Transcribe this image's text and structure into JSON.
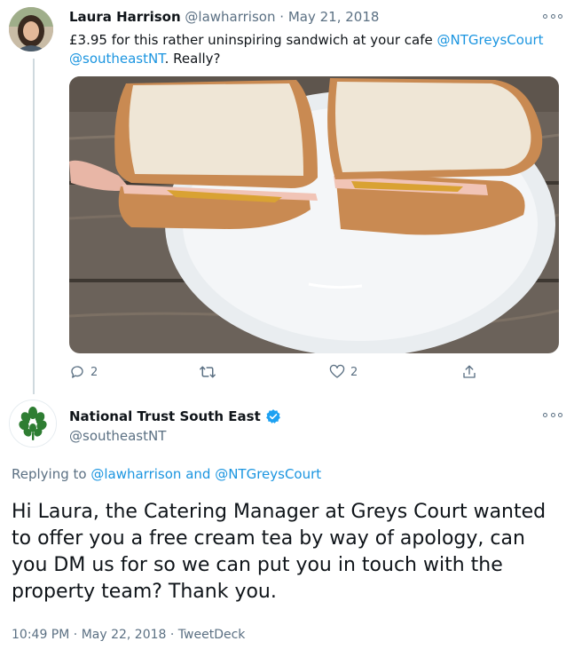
{
  "tweet1": {
    "author_name": "Laura Harrison",
    "author_handle": "@lawharrison",
    "separator": "·",
    "date": "May 21, 2018",
    "text_before": "£3.95 for this rather uninspiring sandwich at your cafe ",
    "mention_1": "@NTGreysCourt",
    "mention_2": "@southeastNT",
    "text_after": ". Really?",
    "reply_count": "2",
    "like_count": "2",
    "photo_icon": "photo-sandwich"
  },
  "tweet2": {
    "author_name": "National Trust South East",
    "author_handle": "@southeastNT",
    "verified_icon": "verified-badge-icon",
    "replying_prefix": "Replying to ",
    "replying_user_1": "@lawharrison",
    "replying_and": " and ",
    "replying_user_2": "@NTGreysCourt",
    "text": "Hi Laura, the Catering Manager at Greys Court wanted to offer you a free cream tea by way of apology, can you DM us for so we can put you in touch with the property team? Thank you.",
    "time": "10:49 PM",
    "separator_1": "·",
    "date": "May 22, 2018",
    "separator_2": "·",
    "source": "TweetDeck"
  },
  "colors": {
    "link": "#1b95e0",
    "muted": "#5b7083",
    "text": "#0f1419",
    "thread_line": "#cfd9de",
    "verified": "#1da1f2",
    "nt_green": "#2e7d32"
  }
}
